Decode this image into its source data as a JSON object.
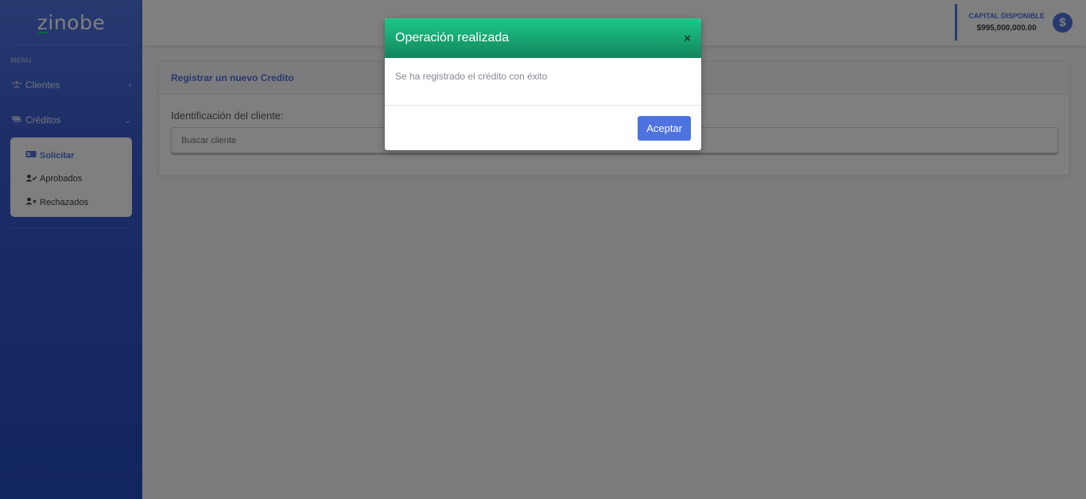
{
  "sidebar": {
    "brand": "zinobe",
    "menu_heading": "MENU",
    "items": [
      {
        "label": "Clientes",
        "icon": "users-icon",
        "chevron": "›"
      },
      {
        "label": "Créditos",
        "icon": "money-icon",
        "chevron": "⌄"
      }
    ],
    "submenu": [
      {
        "label": "Solicitar",
        "icon": "id-card-icon",
        "active": true
      },
      {
        "label": "Aprobados",
        "icon": "user-check-icon",
        "active": false
      },
      {
        "label": "Rechazados",
        "icon": "user-times-icon",
        "active": false
      }
    ]
  },
  "topbar": {
    "capital_label": "CAPITAL DISPONIBLE",
    "capital_value": "$995,000,000.00",
    "capital_icon": "$"
  },
  "card": {
    "title": "Registrar un nuevo Credito",
    "field_label": "Identificación del cliente:",
    "search_placeholder": "Buscar cliente"
  },
  "modal": {
    "title": "Operación realizada",
    "close": "×",
    "message": "Se ha registrado el crédito con éxito",
    "accept_label": "Aceptar"
  },
  "colors": {
    "primary": "#4e73df",
    "success": "#1cc88a"
  }
}
